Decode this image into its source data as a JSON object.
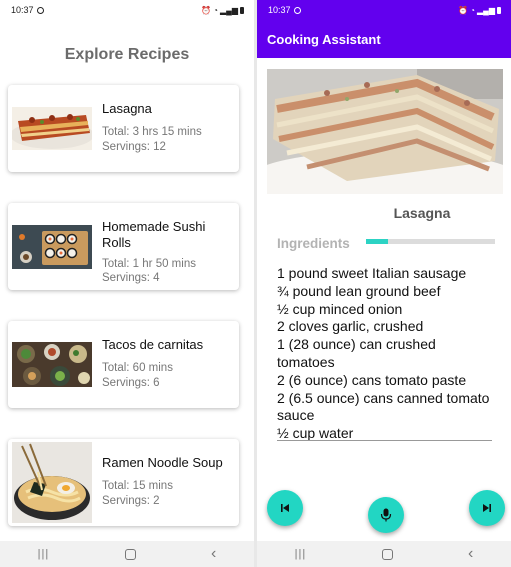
{
  "left_screen": {
    "status": {
      "time": "10:37"
    },
    "title": "Explore Recipes",
    "recipes": [
      {
        "name": "Lasagna",
        "total": "Total: 3 hrs 15 mins",
        "servings": "Servings: 12"
      },
      {
        "name": "Homemade Sushi Rolls",
        "total": "Total: 1 hr 50 mins",
        "servings": "Servings: 4"
      },
      {
        "name": "Tacos de carnitas",
        "total": "Total: 60 mins",
        "servings": "Servings: 6"
      },
      {
        "name": "Ramen Noodle Soup",
        "total": "Total: 15 mins",
        "servings": "Servings: 2"
      }
    ]
  },
  "right_screen": {
    "status": {
      "time": "10:37"
    },
    "app_title": "Cooking Assistant",
    "recipe_title": "Lasagna",
    "section_label": "Ingredients",
    "progress": 0.17,
    "ingredients": [
      "1 pound sweet Italian sausage",
      "¾ pound lean ground beef",
      "½ cup minced onion",
      "2 cloves garlic, crushed",
      "1 (28 ounce) can crushed tomatoes",
      "2 (6 ounce) cans tomato paste",
      "2 (6.5 ounce) cans canned tomato sauce",
      "½ cup water"
    ]
  },
  "icons": {
    "previous": "skip-previous-icon",
    "microphone": "microphone-icon",
    "next": "skip-next-icon"
  },
  "colors": {
    "app_bar": "#6200ee",
    "accent": "#22d6c3",
    "heading_gray": "#6b6b6b"
  }
}
